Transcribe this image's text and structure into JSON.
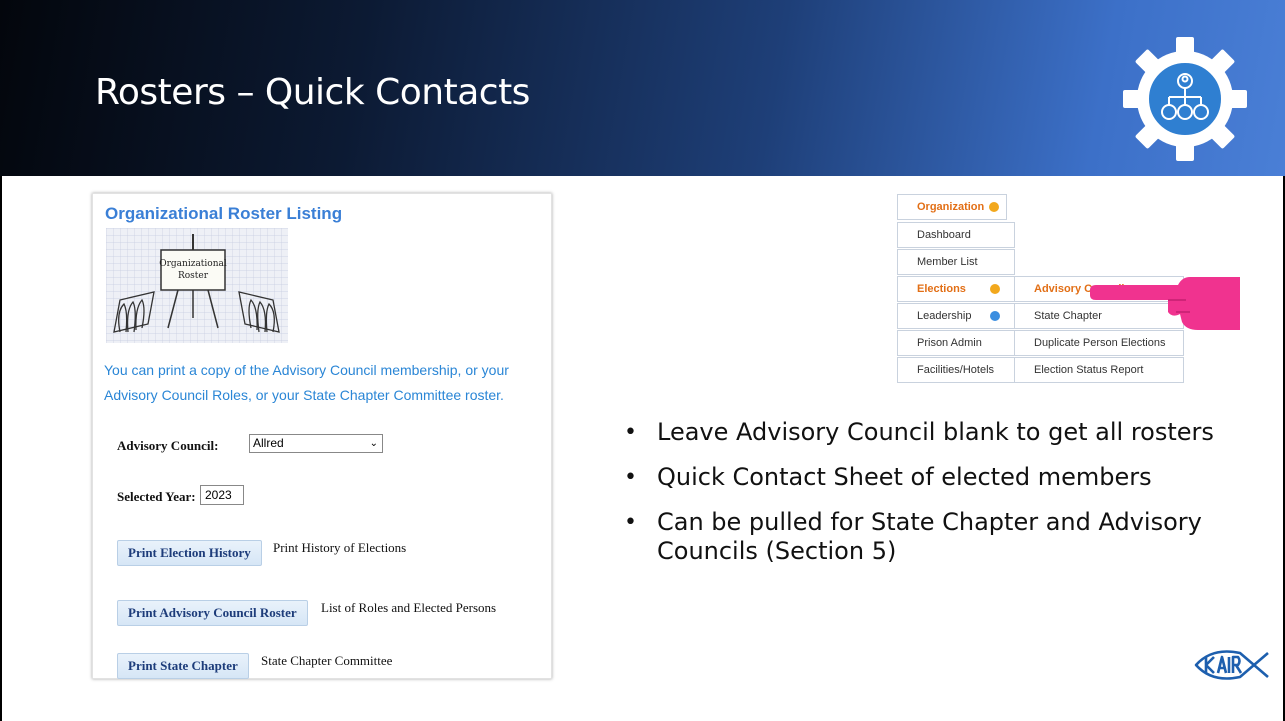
{
  "slide": {
    "title": "Rosters – Quick Contacts"
  },
  "left_panel": {
    "title": "Organizational Roster Listing",
    "image": {
      "line1": "Organizational",
      "line2": "Roster"
    },
    "description": "You can print a copy of the Advisory Council membership, or your Advisory Council Roles, or your State Chapter Committee roster.",
    "advisory_council_label": "Advisory Council:",
    "advisory_council_value": "Allred",
    "selected_year_label": "Selected Year:",
    "selected_year_value": "2023",
    "buttons": [
      {
        "label": "Print Election History",
        "description": "Print History of Elections"
      },
      {
        "label": "Print Advisory Council Roster",
        "description": "List of Roles and Elected Persons"
      },
      {
        "label": "Print State Chapter",
        "description": "State Chapter Committee"
      }
    ]
  },
  "menu": {
    "root": "Organization",
    "items": [
      "Dashboard",
      "Member List",
      "Elections",
      "Leadership",
      "Prison Admin",
      "Facilities/Hotels"
    ],
    "submenu": [
      "Advisory Council",
      "State Chapter",
      "Duplicate Person Elections",
      "Election Status Report"
    ]
  },
  "bullets": [
    "Leave Advisory Council blank to get all rosters",
    "Quick Contact Sheet of elected members",
    "Can be pulled for State Chapter and Advisory Councils (Section 5)"
  ],
  "icons": {
    "gear": "gear-org-chart-icon",
    "pointer": "hand-pointer-icon",
    "logo": "kairos-logo"
  },
  "colors": {
    "accent_blue": "#3a7fd6",
    "menu_orange": "#e26f16",
    "header_gradient_end": "#4a7fd6",
    "pointer_pink": "#f0338f"
  }
}
